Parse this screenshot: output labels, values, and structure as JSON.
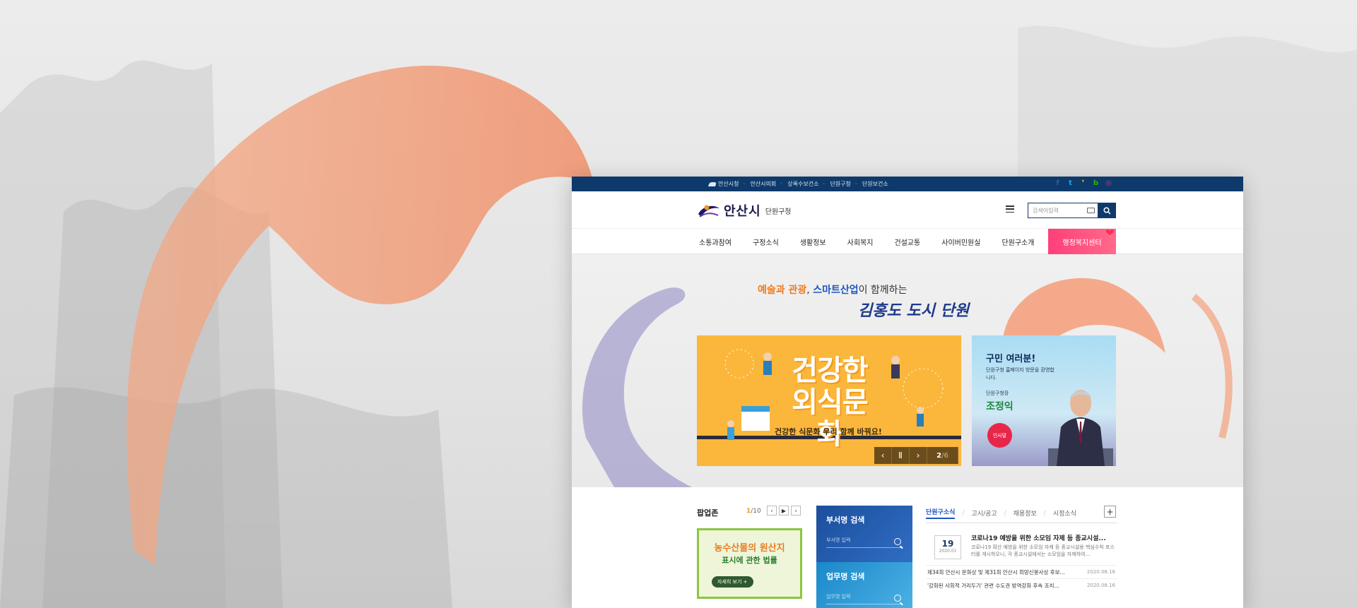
{
  "topbar": {
    "links": [
      "안산시청",
      "안산시의회",
      "상록수보건소",
      "단원구청",
      "단원보건소"
    ],
    "sns": [
      {
        "icon": "facebook-icon",
        "glyph": "f",
        "color": "#3b5998"
      },
      {
        "icon": "twitter-icon",
        "glyph": "t",
        "color": "#1da1f2"
      },
      {
        "icon": "kakao-story-icon",
        "glyph": "❜",
        "color": "#f4c400"
      },
      {
        "icon": "blog-icon",
        "glyph": "b",
        "color": "#2db400"
      },
      {
        "icon": "instagram-icon",
        "glyph": "◎",
        "color": "#c13584"
      }
    ]
  },
  "header": {
    "logo_name": "안산시",
    "logo_sub": "단원구청",
    "search_placeholder": "검색어입력"
  },
  "gnb": {
    "items": [
      "소통과참여",
      "구정소식",
      "생활정보",
      "사회복지",
      "건설교통",
      "사이버민원실",
      "단원구소개"
    ],
    "special": "행정복지센터"
  },
  "hero": {
    "slogan_part1": "예술과 관광",
    "slogan_comma": ", ",
    "slogan_part2": "스마트산업",
    "slogan_part3": "이 함께하는",
    "slogan_line2": "김홍도 도시 단원",
    "banner": {
      "title_line1": "건강한",
      "title_line2": "외식문화",
      "subtitle": "건강한 식문화 우리 함께 바꿔요!",
      "current": "2",
      "total": "/6"
    },
    "mayor": {
      "greeting": "구민 여러분!",
      "message": "단원구청 홈페이지 방문을 환영합니다.",
      "role": "단원구청장",
      "name": "조정익",
      "button": "인사말"
    }
  },
  "popup": {
    "heading": "팝업존",
    "page_current": "1",
    "page_total": "/10",
    "card_line1": "농수산물의 원산지",
    "card_line2": "표시에 관한 법률",
    "card_more": "자세히 보기 +"
  },
  "searches": [
    {
      "label": "부서명 검색",
      "placeholder": "부서명 입력"
    },
    {
      "label": "업무명 검색",
      "placeholder": "업무명 입력"
    }
  ],
  "news": {
    "tabs": [
      "단원구소식",
      "고시/공고",
      "채용정보",
      "시정소식"
    ],
    "main": {
      "day": "19",
      "ym": "2020.01",
      "title": "코로나19 예방을 위한 소모임 자제 등 종교시설...",
      "desc": "코로나19 확산 예방을 위한 소모임 자제 등 종교시설용 핵심수칙 포스터를 게시하오니, 각 종교시설에서는 소모임을 자제하여..."
    },
    "list": [
      {
        "title": "제34회 안산시 문화상 및 제31회 안산시 희망신봉사상 후보...",
        "date": "2020.08.18"
      },
      {
        "title": "'강화된 사회적 거리두기' 관련 수도권 방역강화 후속 조치...",
        "date": "2020.08.16"
      }
    ]
  }
}
